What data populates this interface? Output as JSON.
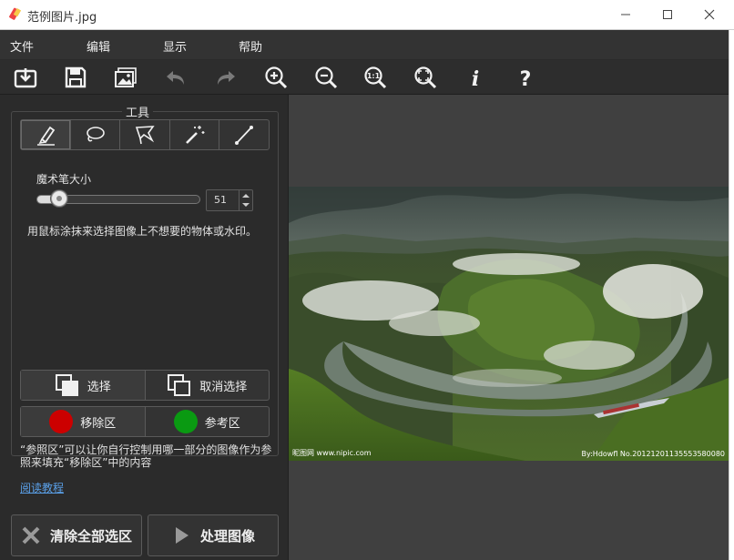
{
  "window": {
    "title": "范例图片.jpg"
  },
  "menu": [
    "文件",
    "编辑",
    "显示",
    "帮助"
  ],
  "toolbar": {
    "icons": [
      "open-icon",
      "save-icon",
      "image-icon",
      "undo-icon",
      "redo-icon",
      "zoom-in-icon",
      "zoom-out-icon",
      "actual-size-icon",
      "fit-window-icon",
      "info-icon",
      "help-icon"
    ]
  },
  "tools": {
    "title": "工具",
    "items": [
      "marker-icon",
      "lasso-icon",
      "polygon-lasso-icon",
      "magic-wand-icon",
      "line-icon"
    ],
    "active": "marker-icon"
  },
  "brush": {
    "label": "魔术笔大小",
    "value": "51",
    "level_fraction": 0.13
  },
  "instruction": "用鼠标涂抹来选择图像上不想要的物体或水印。",
  "selection": {
    "select": "选择",
    "deselect": "取消选择"
  },
  "regions": {
    "remove": "移除区",
    "reference": "参考区",
    "remove_color": "#cc0000",
    "reference_color": "#0a9a12"
  },
  "help_text": "“参照区”可以让你自行控制用哪一部分的图像作为参照来填充“移除区”中的内容",
  "tutorial_link": "阅读教程",
  "actions": {
    "clear": "清除全部选区",
    "process": "处理图像"
  },
  "photo": {
    "watermark_left": "昵图网 www.nipic.com",
    "watermark_right": "By:Hdowfl No.20121201135553580080"
  }
}
